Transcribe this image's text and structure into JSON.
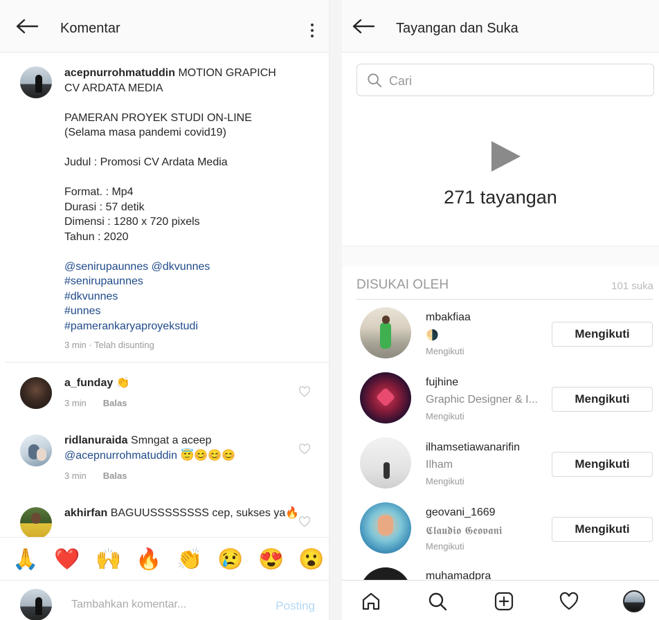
{
  "comments_screen": {
    "title": "Komentar",
    "caption": {
      "username": "acepnurrohmatuddin",
      "line1": "MOTION GRAPICH",
      "line2": "CV ARDATA MEDIA",
      "para2_l1": "PAMERAN PROYEK STUDI ON-LINE",
      "para2_l2": "(Selama masa pandemi covid19)",
      "para3": "Judul : Promosi CV Ardata Media",
      "format": "Format. : Mp4",
      "durasi": "Durasi : 57 detik",
      "dimensi": "Dimensi : 1280 x 720 pixels",
      "tahun": "Tahun : 2020",
      "mentions": "@senirupaunnes @dkvunnes",
      "tags": [
        "#senirupaunnes",
        "#dkvunnes",
        "#unnes",
        "#pamerankaryaproyekstudi"
      ],
      "meta": "3 min · Telah disunting"
    },
    "comments": [
      {
        "username": "a_funday",
        "text": "👏",
        "time": "3 min",
        "reply": "Balas"
      },
      {
        "username": "ridlanuraida",
        "text": "Smngat a aceep",
        "mention": "@acepnurrohmatuddin",
        "emoji": "😇😊😊😊",
        "time": "3 min",
        "reply": "Balas"
      },
      {
        "username": "akhirfan",
        "text": "BAGUUSSSSSSSS cep, sukses ya🔥"
      }
    ],
    "emoji_bar": [
      "🙏",
      "❤️",
      "🙌",
      "🔥",
      "👏",
      "😢",
      "😍",
      "😮"
    ],
    "composer_placeholder": "Tambahkan komentar...",
    "post_label": "Posting",
    "colors": {
      "link": "#1f4a8a",
      "post_disabled": "#b3d8f5"
    }
  },
  "views_screen": {
    "title": "Tayangan dan Suka",
    "search_placeholder": "Cari",
    "views_count": "271 tayangan",
    "liked_by_title": "DISUKAI OLEH",
    "likes_count": "101 suka",
    "users": [
      {
        "username": "mbakfiaa",
        "fullname": "🌗",
        "status": "Mengikuti",
        "button": "Mengikuti"
      },
      {
        "username": "fujhine",
        "fullname": "Graphic Designer & I...",
        "status": "Mengikuti",
        "button": "Mengikuti"
      },
      {
        "username": "ilhamsetiawanarifin",
        "fullname": "Ilham",
        "status": "Mengikuti",
        "button": "Mengikuti"
      },
      {
        "username": "geovani_1669",
        "fullname": "𝕮𝖑𝖆𝖚𝖉𝖎𝖔 𝕲𝖊𝖔𝖛𝖆𝖓𝖎",
        "status": "Mengikuti",
        "button": "Mengikuti"
      },
      {
        "username": "muhamadpra"
      }
    ],
    "nav_icons": [
      "home-icon",
      "search-icon",
      "add-post-icon",
      "activity-heart-icon",
      "profile-avatar-icon"
    ]
  }
}
